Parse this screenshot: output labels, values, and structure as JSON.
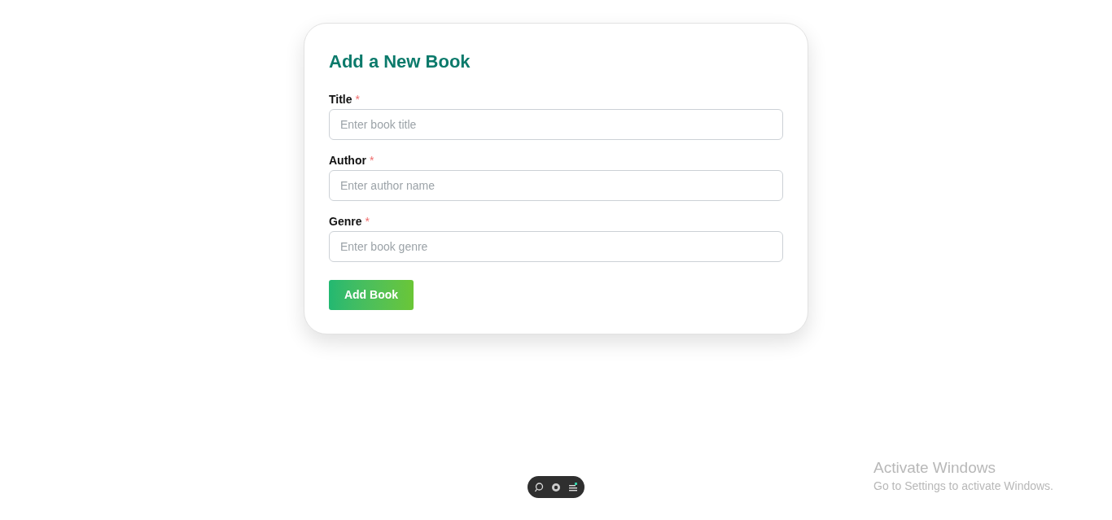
{
  "form": {
    "title": "Add a New Book",
    "fields": [
      {
        "label": "Title",
        "required": true,
        "marker": "*",
        "placeholder": "Enter book title"
      },
      {
        "label": "Author",
        "required": true,
        "marker": "*",
        "placeholder": "Enter author name"
      },
      {
        "label": "Genre",
        "required": true,
        "marker": "*",
        "placeholder": "Enter book genre"
      }
    ],
    "submit": "Add Book"
  },
  "activation_notice": {
    "title": "Activate Windows",
    "text": "Go to Settings to activate Windows."
  }
}
